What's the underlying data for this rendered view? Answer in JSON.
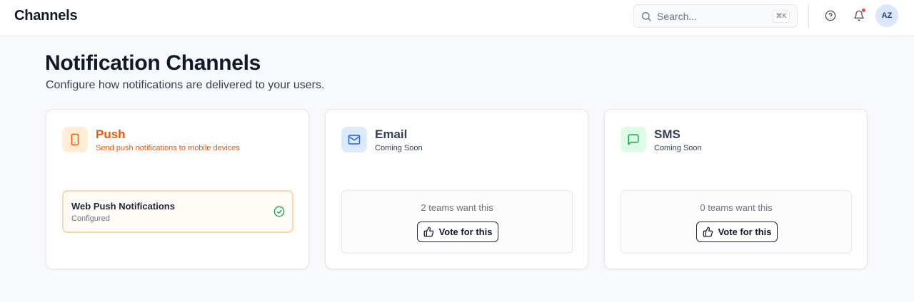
{
  "app": {
    "title": "Channels"
  },
  "search": {
    "placeholder": "Search...",
    "shortcut": "⌘K"
  },
  "user": {
    "initials": "AZ"
  },
  "page": {
    "title": "Notification Channels",
    "subtitle": "Configure how notifications are delivered to your users."
  },
  "channels": {
    "push": {
      "name": "Push",
      "description": "Send push notifications to mobile devices",
      "icon": "smartphone-icon",
      "color": "#ea580c",
      "config": {
        "title": "Web Push Notifications",
        "status": "Configured"
      }
    },
    "email": {
      "name": "Email",
      "description": "Coming Soon",
      "icon": "mail-icon",
      "color": "#2563eb",
      "votes": "2 teams want this",
      "vote_label": "Vote for this"
    },
    "sms": {
      "name": "SMS",
      "description": "Coming Soon",
      "icon": "message-square-icon",
      "color": "#16a34a",
      "votes": "0 teams want this",
      "vote_label": "Vote for this"
    }
  },
  "colors": {
    "notification_dot": "#ef4444",
    "push_accent": "#ea580c",
    "email_accent": "#2563eb",
    "sms_accent": "#16a34a",
    "configured_check": "#16a34a"
  }
}
